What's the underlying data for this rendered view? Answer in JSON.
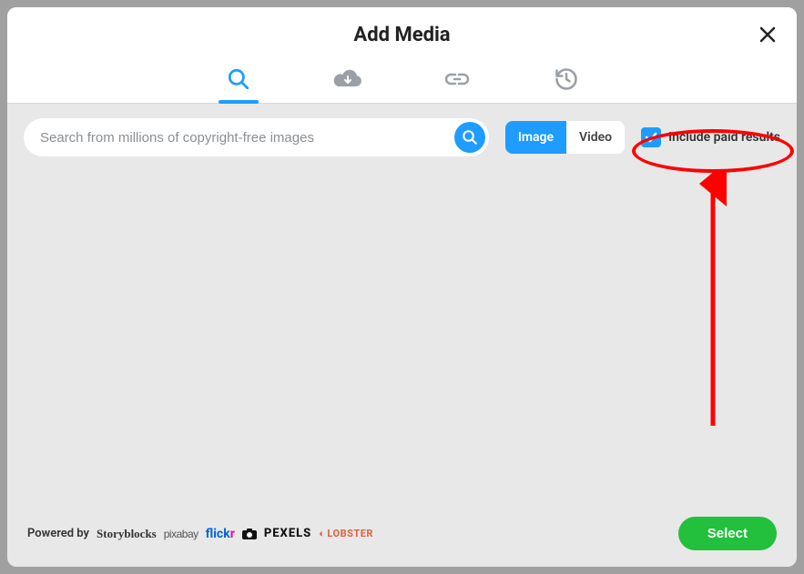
{
  "header": {
    "title": "Add Media"
  },
  "tabs": {
    "search_icon": "search-icon",
    "cloud_icon": "cloud-download-icon",
    "link_icon": "link-icon",
    "history_icon": "history-icon"
  },
  "search": {
    "placeholder": "Search from millions of copyright-free images"
  },
  "mediaToggle": {
    "image": "Image",
    "video": "Video"
  },
  "paid": {
    "label": "Include paid results",
    "checked": true
  },
  "footer": {
    "powered_label": "Powered by",
    "brands": {
      "storyblocks": "Storyblocks",
      "pixabay": "pixabay",
      "flickr_a": "flick",
      "flickr_b": "r",
      "pexels": "PEXELS",
      "lobster": "LOBSTER"
    },
    "select_label": "Select"
  }
}
